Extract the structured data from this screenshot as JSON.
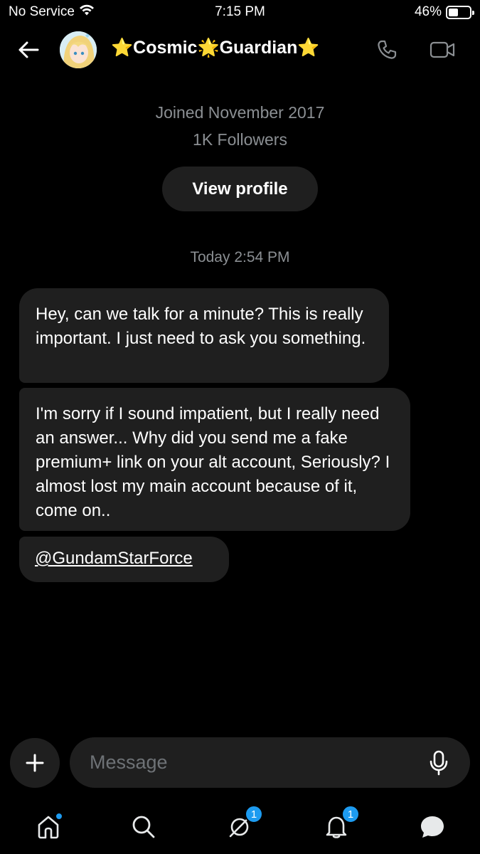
{
  "status_bar": {
    "carrier": "No Service",
    "time": "7:15 PM",
    "battery": "46%",
    "battery_level": 0.46
  },
  "header": {
    "name_part1": "Cosmic",
    "name_part2": "Guardian",
    "name_glyph_star": "⭐",
    "name_glyph_sparkle": "🌟"
  },
  "profile": {
    "joined": "Joined November 2017",
    "followers": "1K Followers",
    "view_profile_label": "View profile"
  },
  "conversation": {
    "timestamp": "Today 2:54 PM",
    "messages": [
      {
        "text": "Hey, can we talk for a minute? This is really important. I just need to ask you something."
      },
      {
        "text": "I'm sorry if I sound impatient, but I really need an answer... Why did you send me a fake premium+ link on your alt account, Seriously? I almost lost my main account because of it, come on.."
      },
      {
        "text": "@GundamStarForce"
      }
    ]
  },
  "composer": {
    "placeholder": "Message"
  },
  "bottom_nav": {
    "items": [
      {
        "icon": "home-icon",
        "has_dot": true
      },
      {
        "icon": "search-icon"
      },
      {
        "icon": "grok-icon",
        "badge": "1"
      },
      {
        "icon": "bell-icon",
        "badge": "1"
      },
      {
        "icon": "messages-icon"
      }
    ]
  },
  "colors": {
    "background": "#000000",
    "bubble": "#1f1f1f",
    "muted_text": "#8b8f93",
    "accent": "#1d9bf0"
  }
}
